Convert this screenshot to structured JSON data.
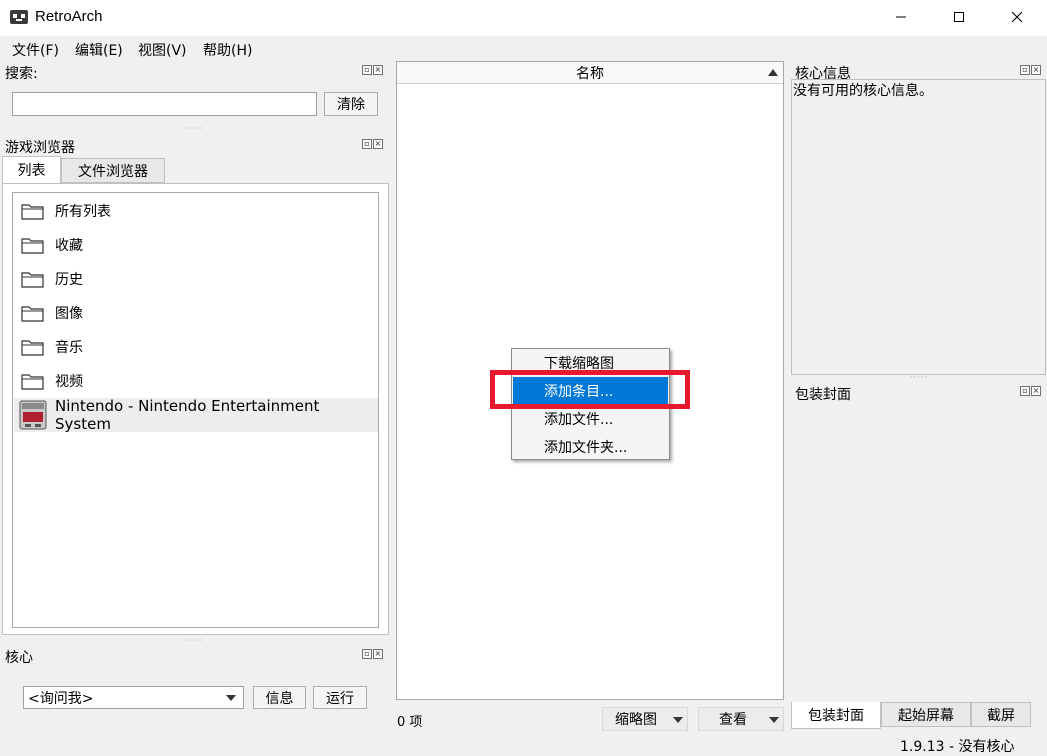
{
  "window": {
    "title": "RetroArch",
    "minimize": "—",
    "maximize": "☐",
    "close": "✕"
  },
  "menu": [
    "文件(F)",
    "编辑(E)",
    "视图(V)",
    "帮助(H)"
  ],
  "search": {
    "title": "搜索:",
    "value": "",
    "clear_label": "清除"
  },
  "browser": {
    "title": "游戏浏览器",
    "tabs": [
      "列表",
      "文件浏览器"
    ],
    "items": [
      {
        "label": "所有列表",
        "icon": "folder-icon"
      },
      {
        "label": "收藏",
        "icon": "folder-icon"
      },
      {
        "label": "历史",
        "icon": "folder-icon"
      },
      {
        "label": "图像",
        "icon": "folder-icon"
      },
      {
        "label": "音乐",
        "icon": "folder-icon"
      },
      {
        "label": "视频",
        "icon": "folder-icon"
      },
      {
        "label": "Nintendo - Nintendo Entertainment System",
        "icon": "nes-console-icon"
      }
    ]
  },
  "core": {
    "title": "核心",
    "select_value": "<询问我>",
    "info_label": "信息",
    "run_label": "运行"
  },
  "center": {
    "column_header": "名称",
    "item_count": "0 项",
    "thumbnail_label": "缩略图",
    "view_label": "查看"
  },
  "context_menu": {
    "items": [
      "下载缩略图",
      "添加条目...",
      "添加文件...",
      "添加文件夹..."
    ],
    "selected_index": 1
  },
  "core_info": {
    "title": "核心信息",
    "text": "没有可用的核心信息。"
  },
  "cover": {
    "title": "包装封面",
    "tabs": [
      "包装封面",
      "起始屏幕",
      "截屏"
    ]
  },
  "status": {
    "text": "1.9.13 - 没有核心"
  },
  "colors": {
    "highlight": "#e8192c",
    "selection": "#0078d7"
  }
}
